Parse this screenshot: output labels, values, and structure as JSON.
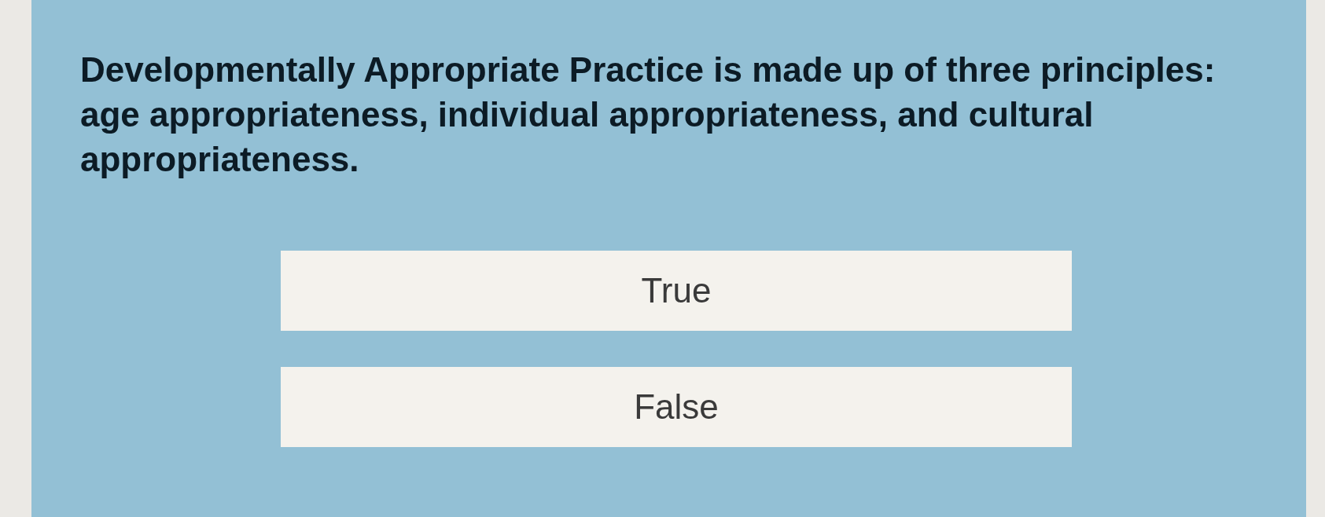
{
  "question": {
    "text": "Developmentally Appropriate Practice is made up of three principles: age appropriateness, individual appropriateness, and cultural appropriateness."
  },
  "options": [
    {
      "label": "True",
      "selected": false
    },
    {
      "label": "False",
      "selected": false
    }
  ]
}
